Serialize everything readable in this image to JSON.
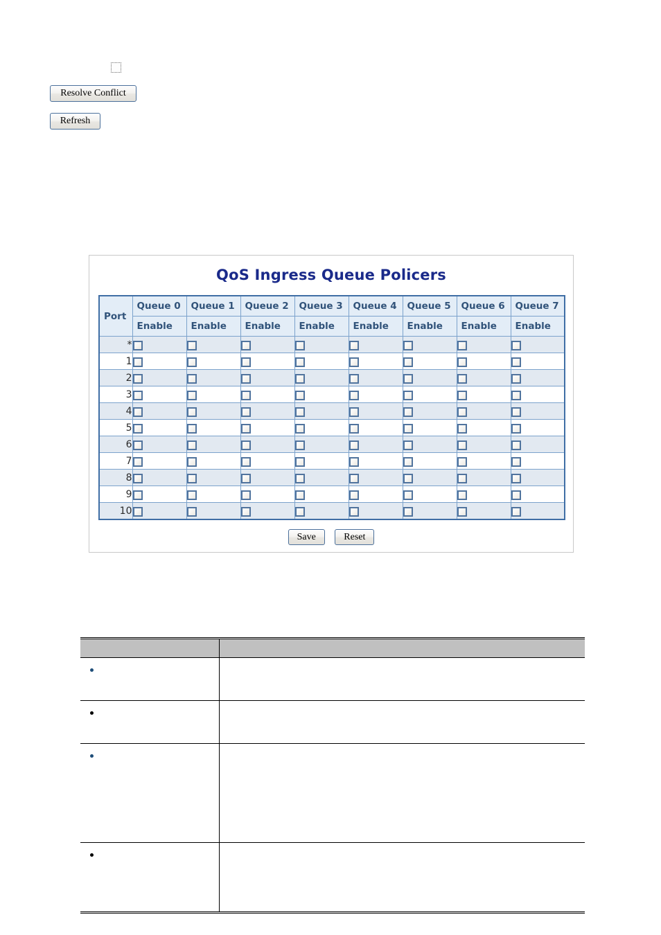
{
  "top_fragment": {
    "checkbox": {
      "name": "stray-checkbox",
      "checked": false
    },
    "resolve_conflict_label": "Resolve Conflict",
    "refresh_label": "Refresh"
  },
  "qos_panel": {
    "title": "QoS Ingress Queue Policers",
    "table": {
      "port_header": "Port",
      "queue_headers": [
        "Queue 0",
        "Queue 1",
        "Queue 2",
        "Queue 3",
        "Queue 4",
        "Queue 5",
        "Queue 6",
        "Queue 7"
      ],
      "sub_headers": [
        "Enable",
        "Enable",
        "Enable",
        "Enable",
        "Enable",
        "Enable",
        "Enable",
        "Enable"
      ],
      "rows": [
        {
          "port": "*",
          "enabled": [
            false,
            false,
            false,
            false,
            false,
            false,
            false,
            false
          ]
        },
        {
          "port": "1",
          "enabled": [
            false,
            false,
            false,
            false,
            false,
            false,
            false,
            false
          ]
        },
        {
          "port": "2",
          "enabled": [
            false,
            false,
            false,
            false,
            false,
            false,
            false,
            false
          ]
        },
        {
          "port": "3",
          "enabled": [
            false,
            false,
            false,
            false,
            false,
            false,
            false,
            false
          ]
        },
        {
          "port": "4",
          "enabled": [
            false,
            false,
            false,
            false,
            false,
            false,
            false,
            false
          ]
        },
        {
          "port": "5",
          "enabled": [
            false,
            false,
            false,
            false,
            false,
            false,
            false,
            false
          ]
        },
        {
          "port": "6",
          "enabled": [
            false,
            false,
            false,
            false,
            false,
            false,
            false,
            false
          ]
        },
        {
          "port": "7",
          "enabled": [
            false,
            false,
            false,
            false,
            false,
            false,
            false,
            false
          ]
        },
        {
          "port": "8",
          "enabled": [
            false,
            false,
            false,
            false,
            false,
            false,
            false,
            false
          ]
        },
        {
          "port": "9",
          "enabled": [
            false,
            false,
            false,
            false,
            false,
            false,
            false,
            false
          ]
        },
        {
          "port": "10",
          "enabled": [
            false,
            false,
            false,
            false,
            false,
            false,
            false,
            false
          ]
        }
      ]
    },
    "save_label": "Save",
    "reset_label": "Reset"
  },
  "desc_table": {
    "headers": [
      "",
      ""
    ],
    "rows": [
      {
        "bullet": "blue",
        "label": "",
        "description": ""
      },
      {
        "bullet": "black",
        "label": "",
        "description": ""
      },
      {
        "bullet": "blue",
        "label": "",
        "description": ""
      },
      {
        "bullet": "black",
        "label": "",
        "description": ""
      }
    ]
  },
  "colors": {
    "title_blue": "#1a2a8a",
    "table_border": "#3f6ea5",
    "header_bg": "#e3edf7",
    "header_text": "#31537a",
    "stripe_bg": "#e2e9f1",
    "desc_header_bg": "#c0c0c0",
    "bullet_blue": "#1f4e79"
  }
}
